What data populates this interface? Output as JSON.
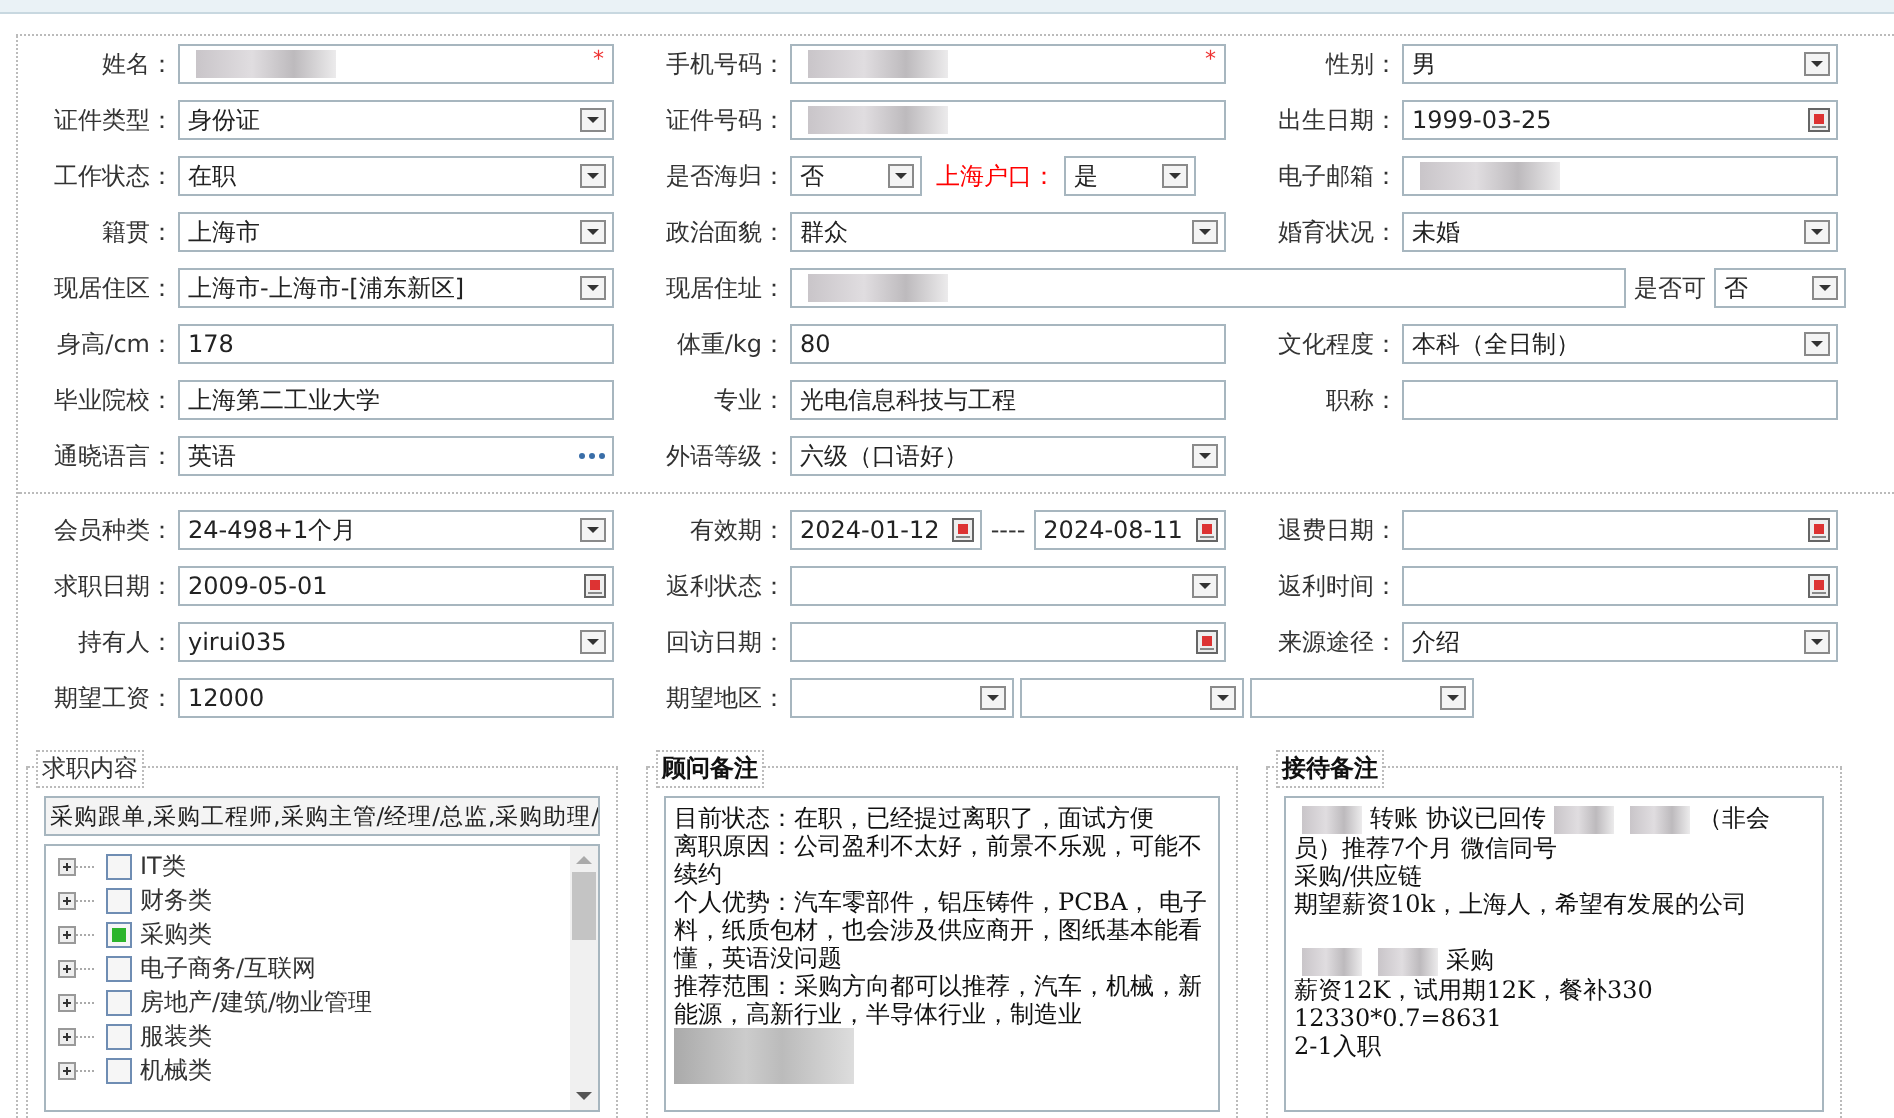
{
  "form": {
    "sections": [
      {
        "rows": [
          {
            "cells": [
              {
                "label": "姓名：",
                "controls": [
                  {
                    "kind": "redacted",
                    "mark": "*"
                  }
                ]
              },
              {
                "label": "手机号码：",
                "controls": [
                  {
                    "kind": "redacted",
                    "mark": "*"
                  }
                ]
              },
              {
                "label": "性别：",
                "controls": [
                  {
                    "kind": "select",
                    "value": "男"
                  }
                ]
              }
            ]
          },
          {
            "cells": [
              {
                "label": "证件类型：",
                "controls": [
                  {
                    "kind": "select",
                    "value": "身份证"
                  }
                ]
              },
              {
                "label": "证件号码：",
                "controls": [
                  {
                    "kind": "redacted"
                  }
                ]
              },
              {
                "label": "出生日期：",
                "controls": [
                  {
                    "kind": "date",
                    "value": "1999-03-25"
                  }
                ]
              }
            ]
          },
          {
            "cells": [
              {
                "label": "工作状态：",
                "controls": [
                  {
                    "kind": "select",
                    "value": "在职"
                  }
                ]
              },
              {
                "label": "是否海归：",
                "controls": [
                  {
                    "kind": "select",
                    "value": "否"
                  },
                  {
                    "kind": "label",
                    "text": "上海户口：",
                    "color": "#ff0000"
                  },
                  {
                    "kind": "select",
                    "value": "是"
                  }
                ]
              },
              {
                "label": "电子邮箱：",
                "controls": [
                  {
                    "kind": "redacted"
                  }
                ]
              }
            ]
          },
          {
            "cells": [
              {
                "label": "籍贯：",
                "controls": [
                  {
                    "kind": "select",
                    "value": "上海市"
                  }
                ]
              },
              {
                "label": "政治面貌：",
                "controls": [
                  {
                    "kind": "select",
                    "value": "群众"
                  }
                ]
              },
              {
                "label": "婚育状况：",
                "controls": [
                  {
                    "kind": "select",
                    "value": "未婚"
                  }
                ]
              }
            ]
          },
          {
            "cells": [
              {
                "label": "现居住区：",
                "controls": [
                  {
                    "kind": "select",
                    "value": "上海市-上海市-[浦东新区]"
                  }
                ]
              },
              {
                "label": "现居住址：",
                "controls": [
                  {
                    "kind": "redacted"
                  },
                  {
                    "kind": "label",
                    "text": "是否可"
                  },
                  {
                    "kind": "select",
                    "value": "否"
                  }
                ]
              }
            ]
          },
          {
            "cells": [
              {
                "label": "身高/cm：",
                "controls": [
                  {
                    "kind": "text",
                    "value": "178"
                  }
                ]
              },
              {
                "label": "体重/kg：",
                "controls": [
                  {
                    "kind": "text",
                    "value": "80"
                  }
                ]
              },
              {
                "label": "文化程度：",
                "controls": [
                  {
                    "kind": "select",
                    "value": "本科（全日制）"
                  }
                ]
              }
            ]
          },
          {
            "cells": [
              {
                "label": "毕业院校：",
                "controls": [
                  {
                    "kind": "text",
                    "value": "上海第二工业大学"
                  }
                ]
              },
              {
                "label": "专业：",
                "controls": [
                  {
                    "kind": "text",
                    "value": "光电信息科技与工程"
                  }
                ]
              },
              {
                "label": "职称：",
                "controls": [
                  {
                    "kind": "text"
                  }
                ]
              }
            ]
          },
          {
            "cells": [
              {
                "label": "通晓语言：",
                "controls": [
                  {
                    "kind": "dots",
                    "value": "英语"
                  }
                ]
              },
              {
                "label": "外语等级：",
                "controls": [
                  {
                    "kind": "select",
                    "value": "六级（口语好）"
                  }
                ]
              }
            ]
          }
        ]
      },
      {
        "rows": [
          {
            "cells": [
              {
                "label": "会员种类：",
                "controls": [
                  {
                    "kind": "select",
                    "value": "24-498+1个月"
                  }
                ]
              },
              {
                "label": "有效期：",
                "controls": [
                  {
                    "kind": "date",
                    "value": "2024-01-12"
                  },
                  {
                    "kind": "label",
                    "text": "----"
                  },
                  {
                    "kind": "date",
                    "value": "2024-08-11"
                  }
                ]
              },
              {
                "label": "退费日期：",
                "controls": [
                  {
                    "kind": "date"
                  }
                ]
              }
            ]
          },
          {
            "cells": [
              {
                "label": "求职日期：",
                "controls": [
                  {
                    "kind": "date",
                    "value": "2009-05-01"
                  }
                ]
              },
              {
                "label": "返利状态：",
                "controls": [
                  {
                    "kind": "select"
                  }
                ]
              },
              {
                "label": "返利时间：",
                "controls": [
                  {
                    "kind": "date"
                  }
                ]
              }
            ]
          },
          {
            "cells": [
              {
                "label": "持有人：",
                "controls": [
                  {
                    "kind": "select",
                    "value": "yirui035"
                  }
                ]
              },
              {
                "label": "回访日期：",
                "controls": [
                  {
                    "kind": "date"
                  }
                ]
              },
              {
                "label": "来源途径：",
                "controls": [
                  {
                    "kind": "select",
                    "value": "介绍"
                  }
                ]
              }
            ]
          },
          {
            "cells": [
              {
                "label": "期望工资：",
                "controls": [
                  {
                    "kind": "text",
                    "value": "12000"
                  }
                ]
              },
              {
                "label": "期望地区：",
                "controls": [
                  {
                    "kind": "select"
                  },
                  {
                    "kind": "select"
                  },
                  {
                    "kind": "select"
                  }
                ]
              }
            ]
          }
        ]
      }
    ]
  },
  "job_panel": {
    "legend": "求职内容",
    "summary": "采购跟单,采购工程师,采购主管/经理/总监,采购助理/",
    "tree": [
      {
        "label": "IT类",
        "checked": false
      },
      {
        "label": "财务类",
        "checked": false
      },
      {
        "label": "采购类",
        "checked": true
      },
      {
        "label": "电子商务/互联网",
        "checked": false
      },
      {
        "label": "房地产/建筑/物业管理",
        "checked": false
      },
      {
        "label": "服装类",
        "checked": false
      },
      {
        "label": "机械类",
        "checked": false
      }
    ]
  },
  "notes": [
    {
      "legend": "顾问备注",
      "paragraphs": [
        {
          "kind": "text",
          "segments": [
            {
              "kind": "text",
              "text": "目前状态：在职，已经提过离职了，面试方便"
            }
          ]
        },
        {
          "kind": "text",
          "segments": [
            {
              "kind": "text",
              "text": "离职原因：公司盈利不太好，前景不乐观，可能不续约"
            }
          ]
        },
        {
          "kind": "text",
          "segments": [
            {
              "kind": "text",
              "text": "个人优势：汽车零部件，铝压铸件，PCBA， 电子料，纸质包材，也会涉及供应商开，图纸基本能看懂，英语没问题"
            }
          ]
        },
        {
          "kind": "text",
          "segments": [
            {
              "kind": "text",
              "text": "推荐范围：采购方向都可以推荐，汽车，机械，新能源，高新行业，半导体行业，制造业"
            }
          ]
        },
        {
          "kind": "blur_block"
        }
      ]
    },
    {
      "legend": "接待备注",
      "paragraphs": [
        {
          "kind": "text",
          "segments": [
            {
              "kind": "blur"
            },
            {
              "kind": "text",
              "text": "转账 协议已回传"
            },
            {
              "kind": "blur"
            },
            {
              "kind": "blur"
            },
            {
              "kind": "text",
              "text": "（非会"
            }
          ]
        },
        {
          "kind": "text",
          "segments": [
            {
              "kind": "text",
              "text": "员）推荐7个月  微信同号"
            }
          ]
        },
        {
          "kind": "text",
          "segments": [
            {
              "kind": "text",
              "text": "采购/供应链"
            }
          ]
        },
        {
          "kind": "text",
          "segments": [
            {
              "kind": "text",
              "text": "期望薪资10k，上海人，希望有发展的公司"
            }
          ]
        },
        {
          "kind": "blank"
        },
        {
          "kind": "text",
          "segments": [
            {
              "kind": "blur"
            },
            {
              "kind": "blur"
            },
            {
              "kind": "text",
              "text": "采购"
            }
          ]
        },
        {
          "kind": "text",
          "segments": [
            {
              "kind": "text",
              "text": "薪资12K，试用期12K，餐补330"
            }
          ]
        },
        {
          "kind": "text",
          "segments": [
            {
              "kind": "text",
              "text": "12330*0.7=8631"
            }
          ]
        },
        {
          "kind": "text",
          "segments": [
            {
              "kind": "text",
              "text": "2-1入职"
            }
          ]
        }
      ]
    }
  ]
}
